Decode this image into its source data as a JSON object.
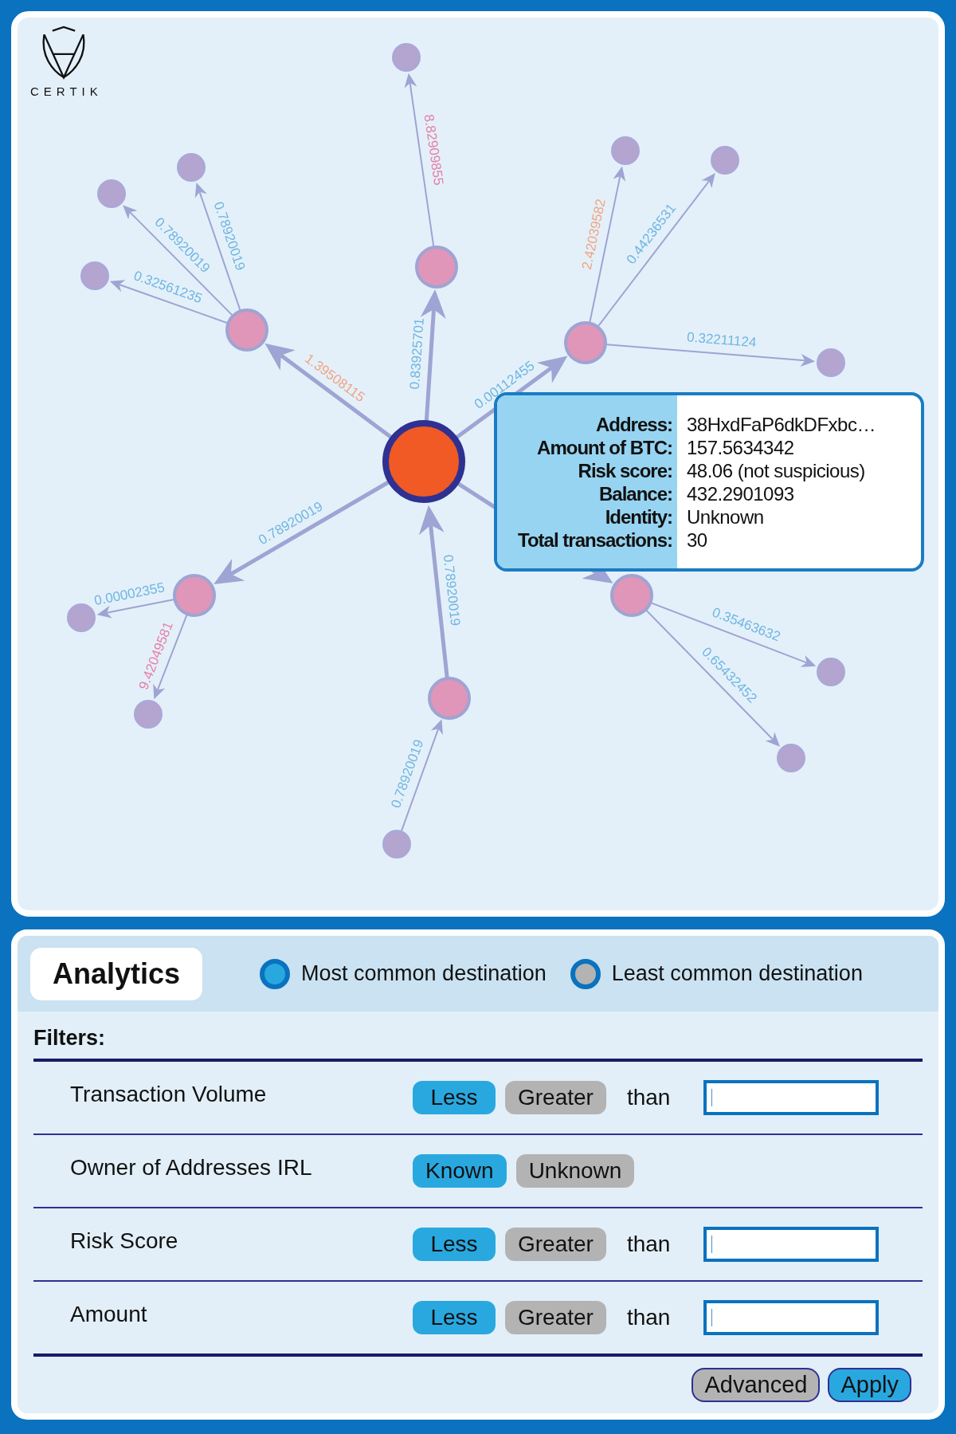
{
  "logo": {
    "text": "CERTIK"
  },
  "graph": {
    "hubs": [
      {
        "edge_label": "1.39508115",
        "color": "#f0a585",
        "kind": "out",
        "leaves": [
          {
            "edge_label": "0.78920019",
            "color": "#6fb6e3",
            "kind": "out"
          },
          {
            "edge_label": "0.78920019",
            "color": "#6fb6e3",
            "kind": "out"
          },
          {
            "edge_label": "0.32561235",
            "color": "#6fb6e3",
            "kind": "out"
          }
        ]
      },
      {
        "edge_label": "0.83925701",
        "color": "#6fb6e3",
        "kind": "out",
        "leaves": [
          {
            "edge_label": "8.82909855",
            "color": "#e57fa8",
            "kind": "out"
          }
        ]
      },
      {
        "edge_label": "0.00112455",
        "color": "#6fb6e3",
        "kind": "out",
        "leaves": [
          {
            "edge_label": "2.42039582",
            "color": "#f0a585",
            "kind": "out"
          },
          {
            "edge_label": "0.44236531",
            "color": "#6fb6e3",
            "kind": "out"
          },
          {
            "edge_label": "0.32211124",
            "color": "#6fb6e3",
            "kind": "out"
          }
        ]
      },
      {
        "kind": "out",
        "leaves": [
          {
            "edge_label": "0.35463632",
            "color": "#6fb6e3",
            "kind": "out"
          },
          {
            "edge_label": "0.65432452",
            "color": "#6fb6e3",
            "kind": "out"
          }
        ]
      },
      {
        "edge_label": "0.78920019",
        "color": "#6fb6e3",
        "kind": "in",
        "leaves": [
          {
            "edge_label": "0.78920019",
            "color": "#6fb6e3",
            "kind": "in"
          }
        ]
      },
      {
        "edge_label": "0.78920019",
        "color": "#6fb6e3",
        "kind": "out",
        "leaves": [
          {
            "edge_label": "0.00002355",
            "color": "#6fb6e3",
            "kind": "out"
          },
          {
            "edge_label": "9.42049581",
            "color": "#e57fa8",
            "kind": "out"
          }
        ]
      }
    ]
  },
  "tooltip": {
    "rows": [
      {
        "label": "Address:",
        "value": "38HxdFaP6dkDFxbc…"
      },
      {
        "label": "Amount of BTC:",
        "value": "157.5634342"
      },
      {
        "label": "Risk score:",
        "value": "48.06 (not suspicious)"
      },
      {
        "label": "Balance:",
        "value": "432.2901093"
      },
      {
        "label": "Identity:",
        "value": "Unknown"
      },
      {
        "label": "Total transactions:",
        "value": "30"
      }
    ]
  },
  "analytics": {
    "title": "Analytics",
    "legend": [
      {
        "label": "Most common destination",
        "color": "#29a8e0"
      },
      {
        "label": "Least common destination",
        "color": "#b3b3b3"
      }
    ],
    "filters_title": "Filters:",
    "filters": [
      {
        "kind": "comparison",
        "label": "Transaction Volume",
        "options": [
          {
            "label": "Less",
            "selected": true
          },
          {
            "label": "Greater",
            "selected": false
          }
        ],
        "suffix": "than"
      },
      {
        "kind": "choice",
        "label": "Owner of Addresses IRL",
        "options": [
          {
            "label": "Known",
            "selected": true
          },
          {
            "label": "Unknown",
            "selected": false
          }
        ]
      },
      {
        "kind": "comparison",
        "label": "Risk Score",
        "options": [
          {
            "label": "Less",
            "selected": true
          },
          {
            "label": "Greater",
            "selected": false
          }
        ],
        "suffix": "than"
      },
      {
        "kind": "comparison",
        "label": "Amount",
        "options": [
          {
            "label": "Less",
            "selected": true
          },
          {
            "label": "Greater",
            "selected": false
          }
        ],
        "suffix": "than"
      }
    ],
    "actions": [
      {
        "label": "Advanced",
        "kind": "secondary"
      },
      {
        "label": "Apply",
        "kind": "primary"
      }
    ]
  }
}
